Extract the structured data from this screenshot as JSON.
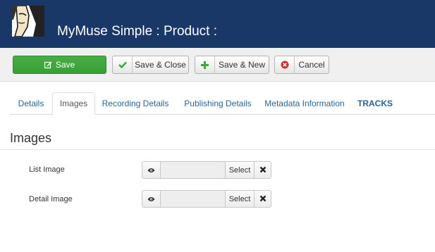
{
  "header": {
    "title": "MyMuse Simple : Product :",
    "logo_icon": "avatar-illustration-icon",
    "background": "#1a3867"
  },
  "toolbar": {
    "save_label": "Save",
    "save_close_label": "Save & Close",
    "save_new_label": "Save & New",
    "cancel_label": "Cancel",
    "accent_green": "#3ca63a",
    "cancel_red": "#c9302c"
  },
  "tabs": [
    {
      "label": "Details"
    },
    {
      "label": "Images"
    },
    {
      "label": "Recording Details"
    },
    {
      "label": "Publishing Details"
    },
    {
      "label": "Metadata Information"
    },
    {
      "label": "TRACKS"
    }
  ],
  "active_tab": "Images",
  "section": {
    "title": "Images",
    "fields": [
      {
        "label": "List Image",
        "value": "",
        "select_label": "Select",
        "preview_icon": "eye-icon",
        "clear_icon": "close-icon"
      },
      {
        "label": "Detail Image",
        "value": "",
        "select_label": "Select",
        "preview_icon": "eye-icon",
        "clear_icon": "close-icon"
      }
    ]
  }
}
